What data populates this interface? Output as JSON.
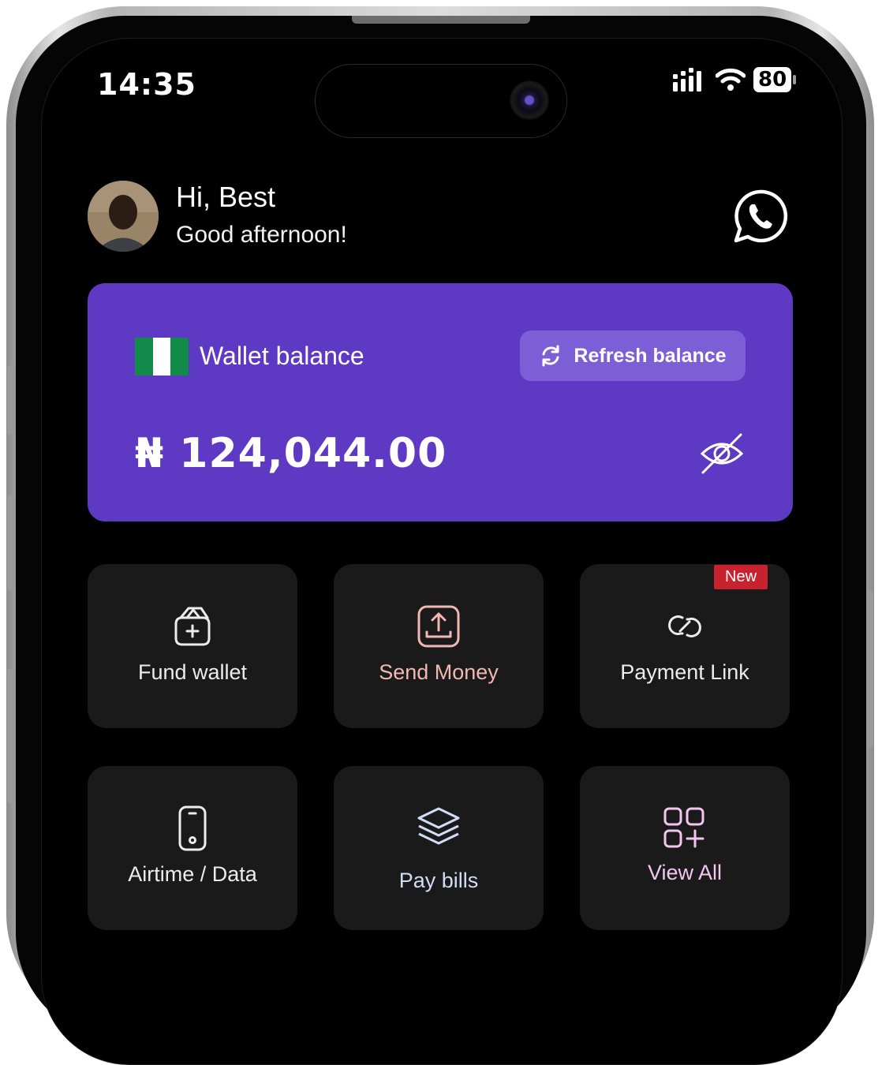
{
  "status_bar": {
    "time": "14:35",
    "battery": "80"
  },
  "header": {
    "greeting": "Hi, Best",
    "subtitle": "Good afternoon!"
  },
  "wallet": {
    "label": "Wallet balance",
    "refresh_label": "Refresh balance",
    "balance": "₦ 124,044.00",
    "flag_colors": [
      "#128a4a",
      "#ffffff",
      "#128a4a"
    ]
  },
  "actions": [
    {
      "label": "Fund wallet",
      "icon": "wallet-plus-icon",
      "color": "#ececec"
    },
    {
      "label": "Send Money",
      "icon": "upload-icon",
      "color": "#f2b8b1"
    },
    {
      "label": "Payment Link",
      "icon": "link-icon",
      "color": "#ececec",
      "badge": "New"
    },
    {
      "label": "Airtime / Data",
      "icon": "phone-icon",
      "color": "#ececec"
    },
    {
      "label": "Pay bills",
      "icon": "layers-icon",
      "color": "#d2dcf6"
    },
    {
      "label": "View All",
      "icon": "grid-plus-icon",
      "color": "#f2c6ee"
    }
  ],
  "colors": {
    "accent": "#5e3ac4",
    "tile": "#1a1a1a",
    "badge": "#c8222e"
  }
}
